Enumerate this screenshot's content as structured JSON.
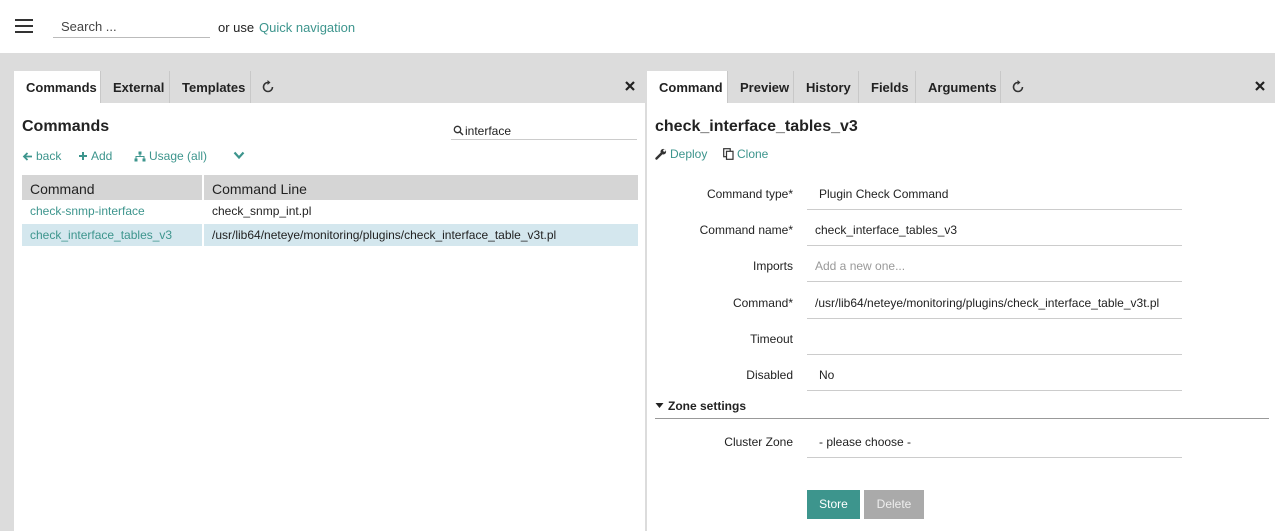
{
  "topbar": {
    "search_placeholder": "Search ...",
    "or_use": "or use",
    "quick_navigation": "Quick navigation"
  },
  "left_panel": {
    "tabs": [
      {
        "label": "Commands",
        "active": true
      },
      {
        "label": "External",
        "active": false
      },
      {
        "label": "Templates",
        "active": false
      }
    ],
    "title": "Commands",
    "search_value": "interface",
    "actions": {
      "back": "back",
      "add": "Add",
      "usage": "Usage (all)"
    },
    "table": {
      "headers": [
        "Command",
        "Command Line"
      ],
      "rows": [
        {
          "command": "check-snmp-interface",
          "command_line": "check_snmp_int.pl",
          "selected": false
        },
        {
          "command": "check_interface_tables_v3",
          "command_line": "/usr/lib64/neteye/monitoring/plugins/check_interface_table_v3t.pl",
          "selected": true
        }
      ]
    }
  },
  "right_panel": {
    "tabs": [
      {
        "label": "Command",
        "active": true
      },
      {
        "label": "Preview",
        "active": false
      },
      {
        "label": "History",
        "active": false
      },
      {
        "label": "Fields",
        "active": false
      },
      {
        "label": "Arguments",
        "active": false
      }
    ],
    "title": "check_interface_tables_v3",
    "actions": {
      "deploy": "Deploy",
      "clone": "Clone"
    },
    "form": {
      "command_type": {
        "label": "Command type*",
        "value": "Plugin Check Command"
      },
      "command_name": {
        "label": "Command name*",
        "value": "check_interface_tables_v3"
      },
      "imports": {
        "label": "Imports",
        "placeholder": "Add a new one..."
      },
      "command": {
        "label": "Command*",
        "value": "/usr/lib64/neteye/monitoring/plugins/check_interface_table_v3t.pl"
      },
      "timeout": {
        "label": "Timeout",
        "value": ""
      },
      "disabled": {
        "label": "Disabled",
        "value": "No"
      }
    },
    "zone_settings": {
      "header": "Zone settings",
      "cluster_zone": {
        "label": "Cluster Zone",
        "value": "- please choose -"
      }
    },
    "buttons": {
      "store": "Store",
      "delete": "Delete"
    }
  },
  "colors": {
    "accent": "#3d958d",
    "selected_row": "#d4e7ee",
    "background": "#dcdcdc"
  }
}
